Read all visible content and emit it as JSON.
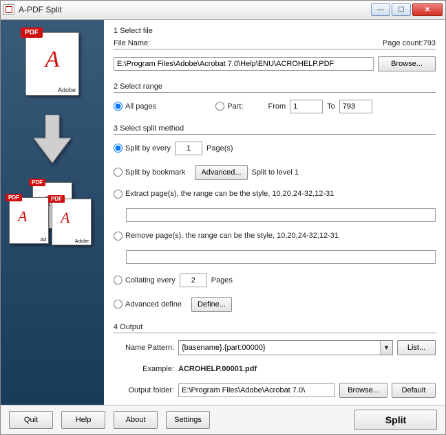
{
  "window": {
    "title": "A-PDF Split"
  },
  "step1": {
    "heading": "1 Select file",
    "file_label": "File Name:",
    "page_count_label": "Page count:",
    "page_count": "793",
    "file_value": "E:\\Program Files\\Adobe\\Acrobat 7.0\\Help\\ENU\\ACROHELP.PDF",
    "browse": "Browse..."
  },
  "step2": {
    "heading": "2 Select range",
    "all": "All pages",
    "part": "Part:",
    "from": "From",
    "to": "To",
    "from_val": "1",
    "to_val": "793"
  },
  "step3": {
    "heading": "3 Select split method",
    "split_every_a": "Split by every",
    "split_every_b": "Page(s)",
    "split_every_val": "1",
    "bookmark": "Split by bookmark",
    "advanced": "Advanced...",
    "bookmark_note": "Split to level 1",
    "extract": "Extract page(s), the range can be the style, 10,20,24-32,12-31",
    "remove": "Remove page(s), the range can be the style, 10,20,24-32,12-31",
    "collate_a": "Collating every",
    "collate_b": "Pages",
    "collate_val": "2",
    "advdef": "Advanced define",
    "define": "Define..."
  },
  "step4": {
    "heading": "4 Output",
    "name_label": "Name Pattern:",
    "name_value": "{basename}.{part:00000}",
    "list": "List...",
    "example_label": "Example:",
    "example_value": "ACROHELP.00001.pdf",
    "outfolder_label": "Output folder:",
    "outfolder_value": "E:\\Program Files\\Adobe\\Acrobat 7.0\\",
    "browse": "Browse...",
    "default": "Default"
  },
  "footer": {
    "quit": "Quit",
    "help": "Help",
    "about": "About",
    "settings": "Settings",
    "split": "Split"
  },
  "sidebar": {
    "pdf_label": "PDF",
    "adobe": "Adobe",
    "ad": "Ad"
  }
}
